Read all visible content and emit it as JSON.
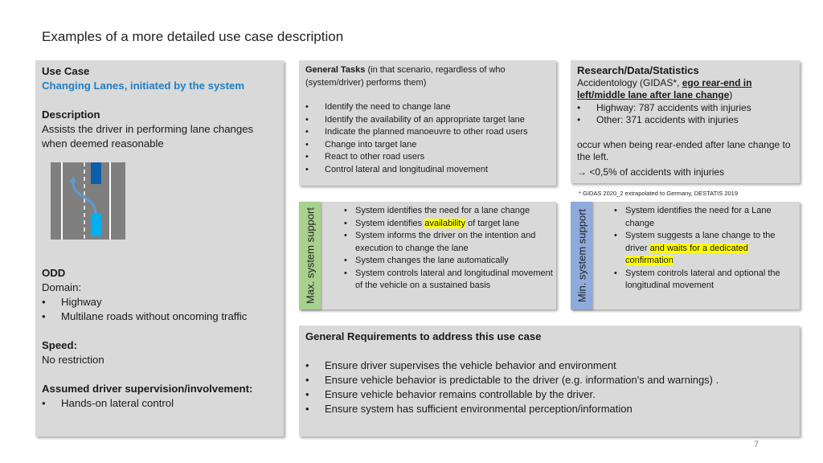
{
  "page_title": "Examples of a more detailed use case description",
  "page_number": "7",
  "colors": {
    "accent_blue": "#1f7fc2",
    "max_tab": "#a9d18e",
    "min_tab": "#8faadc",
    "highlight": "#ffff00",
    "panel": "#d9d9d9"
  },
  "use_case": {
    "heading": "Use Case",
    "name": "Changing Lanes, initiated by the system",
    "description_heading": "Description",
    "description": "Assists the driver in performing lane changes when deemed reasonable",
    "illustration": "lane-change-diagram",
    "odd_heading": "ODD",
    "domain_label": "Domain:",
    "domain_items": [
      "Highway",
      "Multilane roads without oncoming traffic"
    ],
    "speed_heading": "Speed:",
    "speed_value": "No restriction",
    "supervision_heading": "Assumed driver supervision/involvement:",
    "supervision_items": [
      "Hands-on lateral control"
    ]
  },
  "general_tasks": {
    "heading": "General Tasks",
    "subheading": " (in that scenario, regardless of who (system/driver) performs them)",
    "items": [
      "Identify the need to change lane",
      "Identify the availability of an appropriate target lane",
      "Indicate the planned manoeuvre to other road users",
      "Change into target lane",
      "React to other road users",
      "Control lateral and longitudinal movement"
    ]
  },
  "research": {
    "heading": "Research/Data/Statistics",
    "intro_prefix": "Accidentology (GIDAS*, ",
    "intro_underlined": "ego rear-end in left/middle lane after lane change",
    "intro_suffix": ")",
    "items": [
      "Highway: 787 accidents with injuries",
      "Other: 371 accidents with injuries"
    ],
    "note": "occur when being rear-ended after lane change to the left.",
    "conclusion_arrow": "→",
    "conclusion": " <0,5% of accidents with injuries",
    "footnote": "* GIDAS 2020_2 extrapolated to Germany, DESTATIS 2019"
  },
  "max_support": {
    "label": "Max. system support",
    "items": [
      {
        "pre": "System identifies the need for a lane change",
        "hl": "",
        "post": ""
      },
      {
        "pre": "System identifies ",
        "hl": "availability",
        "post": " of target lane"
      },
      {
        "pre": "System informs the driver on the intention and execution to change the lane",
        "hl": "",
        "post": ""
      },
      {
        "pre": "System changes the lane automatically",
        "hl": "",
        "post": ""
      },
      {
        "pre": "System controls lateral and longitudinal movement of the vehicle on a sustained basis",
        "hl": "",
        "post": ""
      }
    ]
  },
  "min_support": {
    "label": "Min. system support",
    "items": [
      {
        "pre": "System identifies the need for a Lane change",
        "hl": "",
        "post": ""
      },
      {
        "pre": "System suggests a lane change to the driver ",
        "hl": "and waits for a dedicated confirmation",
        "post": ""
      },
      {
        "pre": "System controls lateral and optional the longitudinal movement",
        "hl": "",
        "post": ""
      }
    ]
  },
  "requirements": {
    "heading": "General Requirements to address this use case",
    "items": [
      "Ensure driver supervises the vehicle behavior and environment",
      "Ensure vehicle behavior is predictable to the driver (e.g. information's and warnings) .",
      "Ensure vehicle behavior remains controllable by the driver.",
      "Ensure system has sufficient environmental perception/information"
    ]
  }
}
